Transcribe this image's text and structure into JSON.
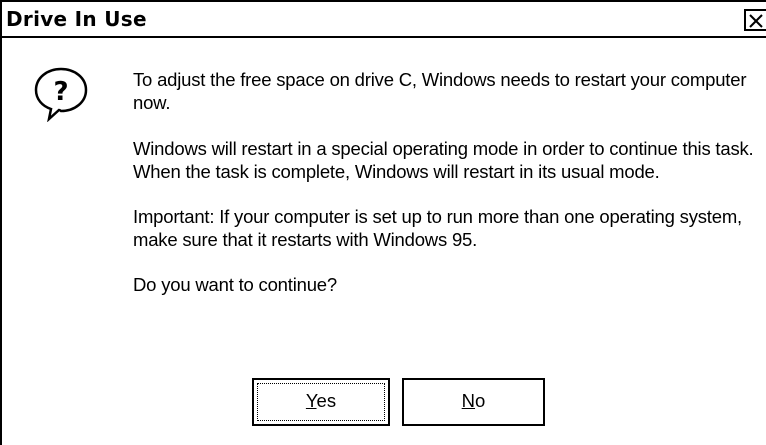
{
  "window": {
    "title": "Drive In Use",
    "close_icon": "close-icon"
  },
  "icon": "question-balloon-icon",
  "message": {
    "p1": "To adjust the free space on drive C, Windows needs to restart your computer now.",
    "p2": "Windows will restart in a special operating mode in order to continue this task. When the task is complete, Windows will restart in its usual mode.",
    "p3": "Important: If your computer is set up to run more than one operating system, make sure that it restarts with Windows 95.",
    "p4": "Do you want to continue?"
  },
  "buttons": {
    "yes": {
      "mnemonic": "Y",
      "rest": "es"
    },
    "no": {
      "mnemonic": "N",
      "rest": "o"
    }
  }
}
